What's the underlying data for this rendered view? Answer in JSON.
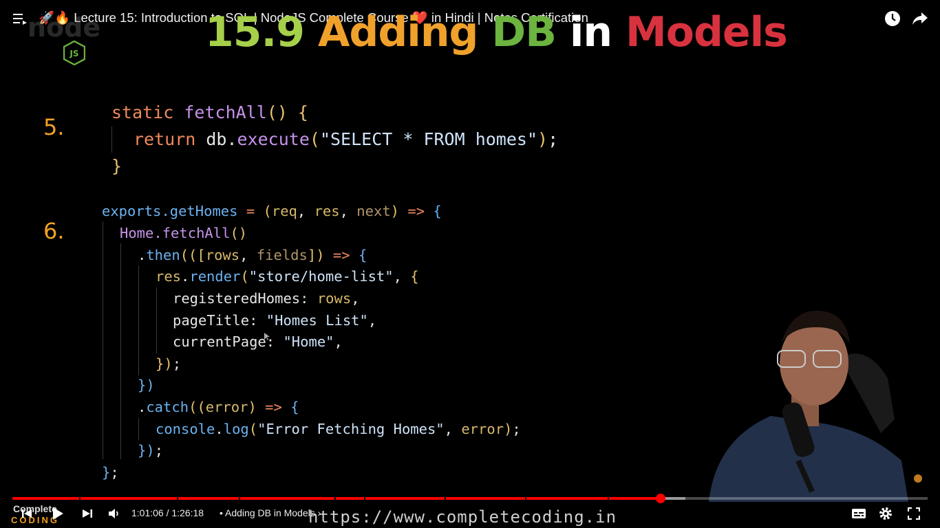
{
  "video": {
    "title": "🚀🔥 Lecture 15: Introduction to SQL | NodeJS Complete Course ❤️ in Hindi | Notes Certification"
  },
  "slide": {
    "title_parts": [
      {
        "text": "15.9",
        "color": "#a6cf4a"
      },
      {
        "text": "Adding",
        "color": "#f0a12b"
      },
      {
        "text": "DB",
        "color": "#6cb33f"
      },
      {
        "text": "in",
        "color": "#ffffff"
      },
      {
        "text": "Models",
        "color": "#d8323f"
      }
    ],
    "steps": [
      "5.",
      "6."
    ],
    "logo_text": "JS"
  },
  "code": {
    "block1": [
      "static fetchAll() {",
      "  return db.execute(\"SELECT * FROM homes\");",
      "}"
    ],
    "block2": [
      "exports.getHomes = (req, res, next) => {",
      "  Home.fetchAll()",
      "    .then(([rows, fields]) => {",
      "      res.render(\"store/home-list\", {",
      "        registeredHomes: rows,",
      "        pageTitle: \"Homes List\",",
      "        currentPage: \"Home\",",
      "      });",
      "    })",
      "    .catch((error) => {",
      "      console.log(\"Error Fetching Homes\", error);",
      "    });",
      "};"
    ]
  },
  "player": {
    "current_time": "1:01:06",
    "duration": "1:26:18",
    "time_display": "1:01:06 / 1:26:18",
    "chapter": "• Adding DB in Models ›",
    "progress_fraction": 0.708,
    "buffered_fraction": 0.735,
    "chapter_marks": [
      0.073,
      0.18,
      0.247,
      0.352,
      0.384,
      0.472,
      0.56,
      0.65
    ],
    "colors": {
      "progress": "#ff0000"
    }
  },
  "watermark": {
    "url": "https://www.completecoding.in",
    "brand_top": "Complete",
    "brand_bottom": "CODING"
  },
  "icons": {
    "top_left": "playlist-menu-icon",
    "top_right": [
      "watch-later-icon",
      "share-icon"
    ],
    "controls_left": [
      "previous-icon",
      "play-icon",
      "next-icon",
      "volume-icon"
    ],
    "controls_right": [
      "subtitles-icon",
      "settings-icon",
      "fullscreen-icon"
    ]
  }
}
